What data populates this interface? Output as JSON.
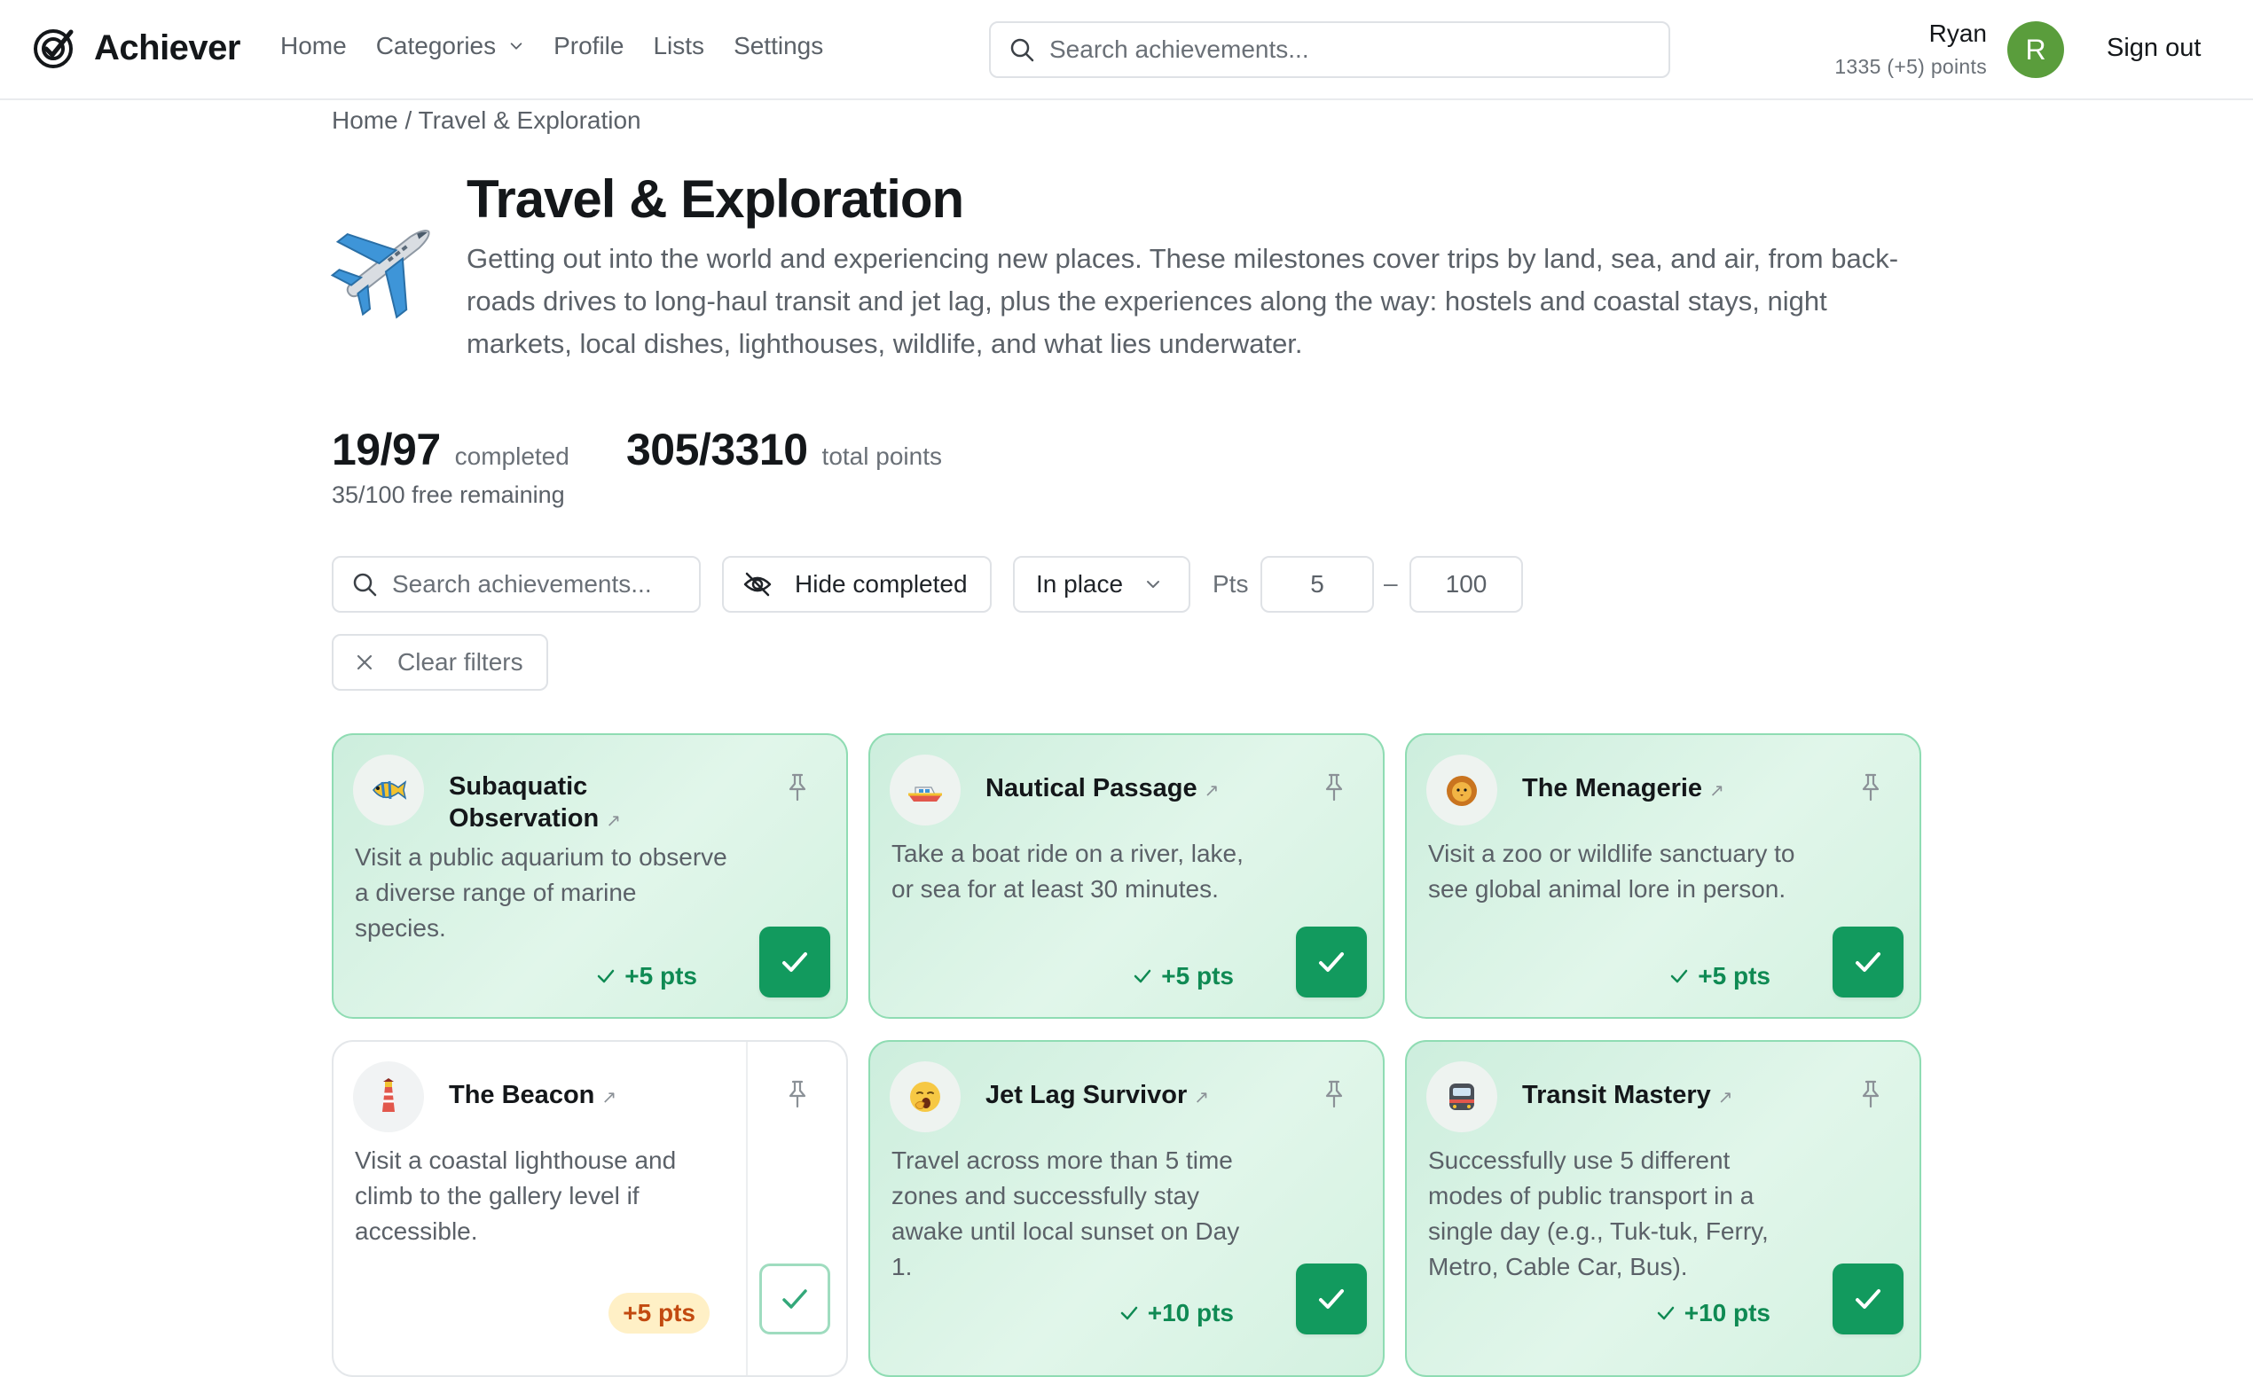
{
  "app": {
    "name": "Achiever"
  },
  "nav": {
    "home": "Home",
    "categories": "Categories",
    "profile": "Profile",
    "lists": "Lists",
    "settings": "Settings"
  },
  "top_search": {
    "placeholder": "Search achievements..."
  },
  "user": {
    "name": "Ryan",
    "points": "1335 (+5) points",
    "avatar_initial": "R",
    "avatar_color": "#5a9d3c",
    "sign_out": "Sign out"
  },
  "breadcrumb": {
    "home": "Home",
    "separator": " / ",
    "current": "Travel & Exploration"
  },
  "category": {
    "icon": "airplane-icon",
    "title": "Travel & Exploration",
    "description": "Getting out into the world and experiencing new places. These milestones cover trips by land, sea, and air, from back-roads drives to long-haul transit and jet lag, plus the experiences along the way: hostels and coastal stays, night markets, local dishes, lighthouses, wildlife, and what lies underwater."
  },
  "stats": {
    "completed_value": "19/97",
    "completed_label": "completed",
    "points_value": "305/3310",
    "points_label": "total points",
    "free_remaining": "35/100 free remaining"
  },
  "filters": {
    "search_placeholder": "Search achievements...",
    "hide_completed": "Hide completed",
    "sort": "In place",
    "pts_label": "Pts",
    "pts_min": "5",
    "pts_dash": "–",
    "pts_max": "100",
    "clear": "Clear filters"
  },
  "colors": {
    "accent_green": "#129a5e",
    "card_done_border": "#8fdcb3",
    "pending_bg": "#fff0c6",
    "pending_text": "#c24a10"
  },
  "cards": [
    {
      "title": "Subaquatic Observation",
      "icon": "tropical-fish-icon",
      "description": "Visit a public aquarium to observe a diverse range of marine species.",
      "points": "+5 pts",
      "completed": true
    },
    {
      "title": "Nautical Passage",
      "icon": "motor-boat-icon",
      "description": "Take a boat ride on a river, lake, or sea for at least 30 minutes.",
      "points": "+5 pts",
      "completed": true
    },
    {
      "title": "The Menagerie",
      "icon": "lion-face-icon",
      "description": "Visit a zoo or wildlife sanctuary to see global animal lore in person.",
      "points": "+5 pts",
      "completed": true
    },
    {
      "title": "The Beacon",
      "icon": "lighthouse-icon",
      "description": "Visit a coastal lighthouse and climb to the gallery level if accessible.",
      "points": "+5 pts",
      "completed": false
    },
    {
      "title": "Jet Lag Survivor",
      "icon": "yawning-face-icon",
      "description": "Travel across more than 5 time zones and successfully stay awake until local sunset on Day 1.",
      "points": "+10 pts",
      "completed": true
    },
    {
      "title": "Transit Mastery",
      "icon": "metro-train-icon",
      "description": "Successfully use 5 different modes of public transport in a single day (e.g., Tuk-tuk, Ferry, Metro, Cable Car, Bus).",
      "points": "+10 pts",
      "completed": true
    }
  ]
}
